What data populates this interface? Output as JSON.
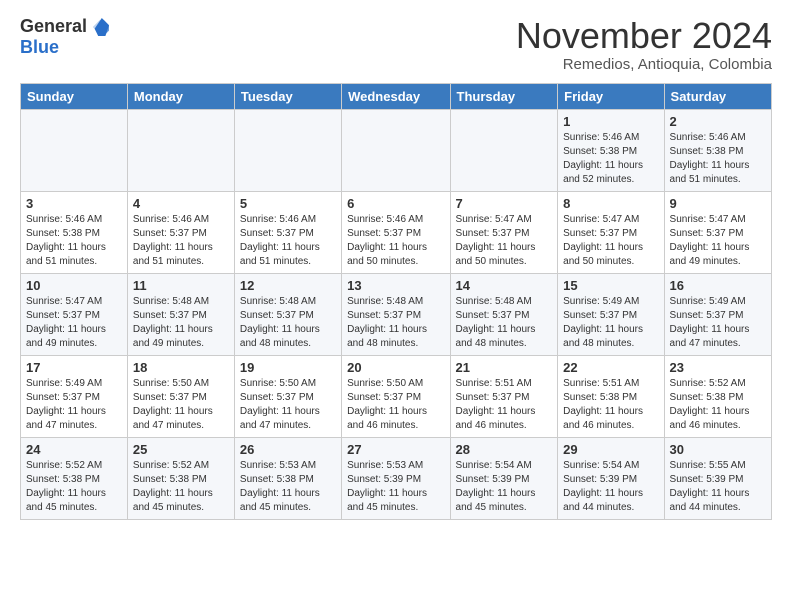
{
  "logo": {
    "general": "General",
    "blue": "Blue"
  },
  "header": {
    "month": "November 2024",
    "location": "Remedios, Antioquia, Colombia"
  },
  "days_of_week": [
    "Sunday",
    "Monday",
    "Tuesday",
    "Wednesday",
    "Thursday",
    "Friday",
    "Saturday"
  ],
  "weeks": [
    [
      {
        "day": "",
        "detail": ""
      },
      {
        "day": "",
        "detail": ""
      },
      {
        "day": "",
        "detail": ""
      },
      {
        "day": "",
        "detail": ""
      },
      {
        "day": "",
        "detail": ""
      },
      {
        "day": "1",
        "detail": "Sunrise: 5:46 AM\nSunset: 5:38 PM\nDaylight: 11 hours\nand 52 minutes."
      },
      {
        "day": "2",
        "detail": "Sunrise: 5:46 AM\nSunset: 5:38 PM\nDaylight: 11 hours\nand 51 minutes."
      }
    ],
    [
      {
        "day": "3",
        "detail": "Sunrise: 5:46 AM\nSunset: 5:38 PM\nDaylight: 11 hours\nand 51 minutes."
      },
      {
        "day": "4",
        "detail": "Sunrise: 5:46 AM\nSunset: 5:37 PM\nDaylight: 11 hours\nand 51 minutes."
      },
      {
        "day": "5",
        "detail": "Sunrise: 5:46 AM\nSunset: 5:37 PM\nDaylight: 11 hours\nand 51 minutes."
      },
      {
        "day": "6",
        "detail": "Sunrise: 5:46 AM\nSunset: 5:37 PM\nDaylight: 11 hours\nand 50 minutes."
      },
      {
        "day": "7",
        "detail": "Sunrise: 5:47 AM\nSunset: 5:37 PM\nDaylight: 11 hours\nand 50 minutes."
      },
      {
        "day": "8",
        "detail": "Sunrise: 5:47 AM\nSunset: 5:37 PM\nDaylight: 11 hours\nand 50 minutes."
      },
      {
        "day": "9",
        "detail": "Sunrise: 5:47 AM\nSunset: 5:37 PM\nDaylight: 11 hours\nand 49 minutes."
      }
    ],
    [
      {
        "day": "10",
        "detail": "Sunrise: 5:47 AM\nSunset: 5:37 PM\nDaylight: 11 hours\nand 49 minutes."
      },
      {
        "day": "11",
        "detail": "Sunrise: 5:48 AM\nSunset: 5:37 PM\nDaylight: 11 hours\nand 49 minutes."
      },
      {
        "day": "12",
        "detail": "Sunrise: 5:48 AM\nSunset: 5:37 PM\nDaylight: 11 hours\nand 48 minutes."
      },
      {
        "day": "13",
        "detail": "Sunrise: 5:48 AM\nSunset: 5:37 PM\nDaylight: 11 hours\nand 48 minutes."
      },
      {
        "day": "14",
        "detail": "Sunrise: 5:48 AM\nSunset: 5:37 PM\nDaylight: 11 hours\nand 48 minutes."
      },
      {
        "day": "15",
        "detail": "Sunrise: 5:49 AM\nSunset: 5:37 PM\nDaylight: 11 hours\nand 48 minutes."
      },
      {
        "day": "16",
        "detail": "Sunrise: 5:49 AM\nSunset: 5:37 PM\nDaylight: 11 hours\nand 47 minutes."
      }
    ],
    [
      {
        "day": "17",
        "detail": "Sunrise: 5:49 AM\nSunset: 5:37 PM\nDaylight: 11 hours\nand 47 minutes."
      },
      {
        "day": "18",
        "detail": "Sunrise: 5:50 AM\nSunset: 5:37 PM\nDaylight: 11 hours\nand 47 minutes."
      },
      {
        "day": "19",
        "detail": "Sunrise: 5:50 AM\nSunset: 5:37 PM\nDaylight: 11 hours\nand 47 minutes."
      },
      {
        "day": "20",
        "detail": "Sunrise: 5:50 AM\nSunset: 5:37 PM\nDaylight: 11 hours\nand 46 minutes."
      },
      {
        "day": "21",
        "detail": "Sunrise: 5:51 AM\nSunset: 5:37 PM\nDaylight: 11 hours\nand 46 minutes."
      },
      {
        "day": "22",
        "detail": "Sunrise: 5:51 AM\nSunset: 5:38 PM\nDaylight: 11 hours\nand 46 minutes."
      },
      {
        "day": "23",
        "detail": "Sunrise: 5:52 AM\nSunset: 5:38 PM\nDaylight: 11 hours\nand 46 minutes."
      }
    ],
    [
      {
        "day": "24",
        "detail": "Sunrise: 5:52 AM\nSunset: 5:38 PM\nDaylight: 11 hours\nand 45 minutes."
      },
      {
        "day": "25",
        "detail": "Sunrise: 5:52 AM\nSunset: 5:38 PM\nDaylight: 11 hours\nand 45 minutes."
      },
      {
        "day": "26",
        "detail": "Sunrise: 5:53 AM\nSunset: 5:38 PM\nDaylight: 11 hours\nand 45 minutes."
      },
      {
        "day": "27",
        "detail": "Sunrise: 5:53 AM\nSunset: 5:39 PM\nDaylight: 11 hours\nand 45 minutes."
      },
      {
        "day": "28",
        "detail": "Sunrise: 5:54 AM\nSunset: 5:39 PM\nDaylight: 11 hours\nand 45 minutes."
      },
      {
        "day": "29",
        "detail": "Sunrise: 5:54 AM\nSunset: 5:39 PM\nDaylight: 11 hours\nand 44 minutes."
      },
      {
        "day": "30",
        "detail": "Sunrise: 5:55 AM\nSunset: 5:39 PM\nDaylight: 11 hours\nand 44 minutes."
      }
    ]
  ]
}
